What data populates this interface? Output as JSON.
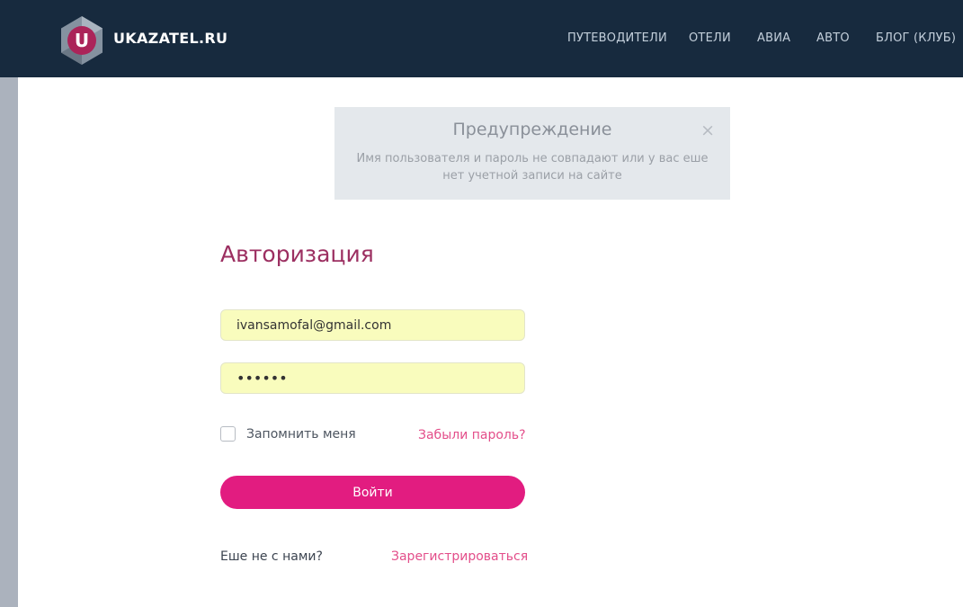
{
  "header": {
    "brand": "UKAZATEL.RU",
    "logo_letter": "U",
    "nav": [
      "ПУТЕВОДИТЕЛИ",
      "ОТЕЛИ",
      "АВИА",
      "АВТО",
      "БЛОГ (КЛУБ)"
    ]
  },
  "alert": {
    "title": "Предупреждение",
    "message": "Имя пользователя и пароль не совпадают или у вас еше нет учетной записи на сайте",
    "close_icon": "close-icon"
  },
  "form": {
    "title": "Авторизация",
    "email_value": "ivansamofal@gmail.com",
    "password_value": "••••••",
    "remember_label": "Запомнить меня",
    "remember_checked": false,
    "forgot_link": "Забыли пароль?",
    "login_button": "Войти",
    "signup_prompt": "Еше не с нами?",
    "signup_link": "Зарегистрироваться"
  },
  "colors": {
    "header_bg": "#172a3e",
    "accent": "#e21c80",
    "title": "#9c2f61",
    "link": "#e34e8a",
    "alert_bg": "#e4e8ec",
    "autofill_bg": "#f9fcbd"
  }
}
